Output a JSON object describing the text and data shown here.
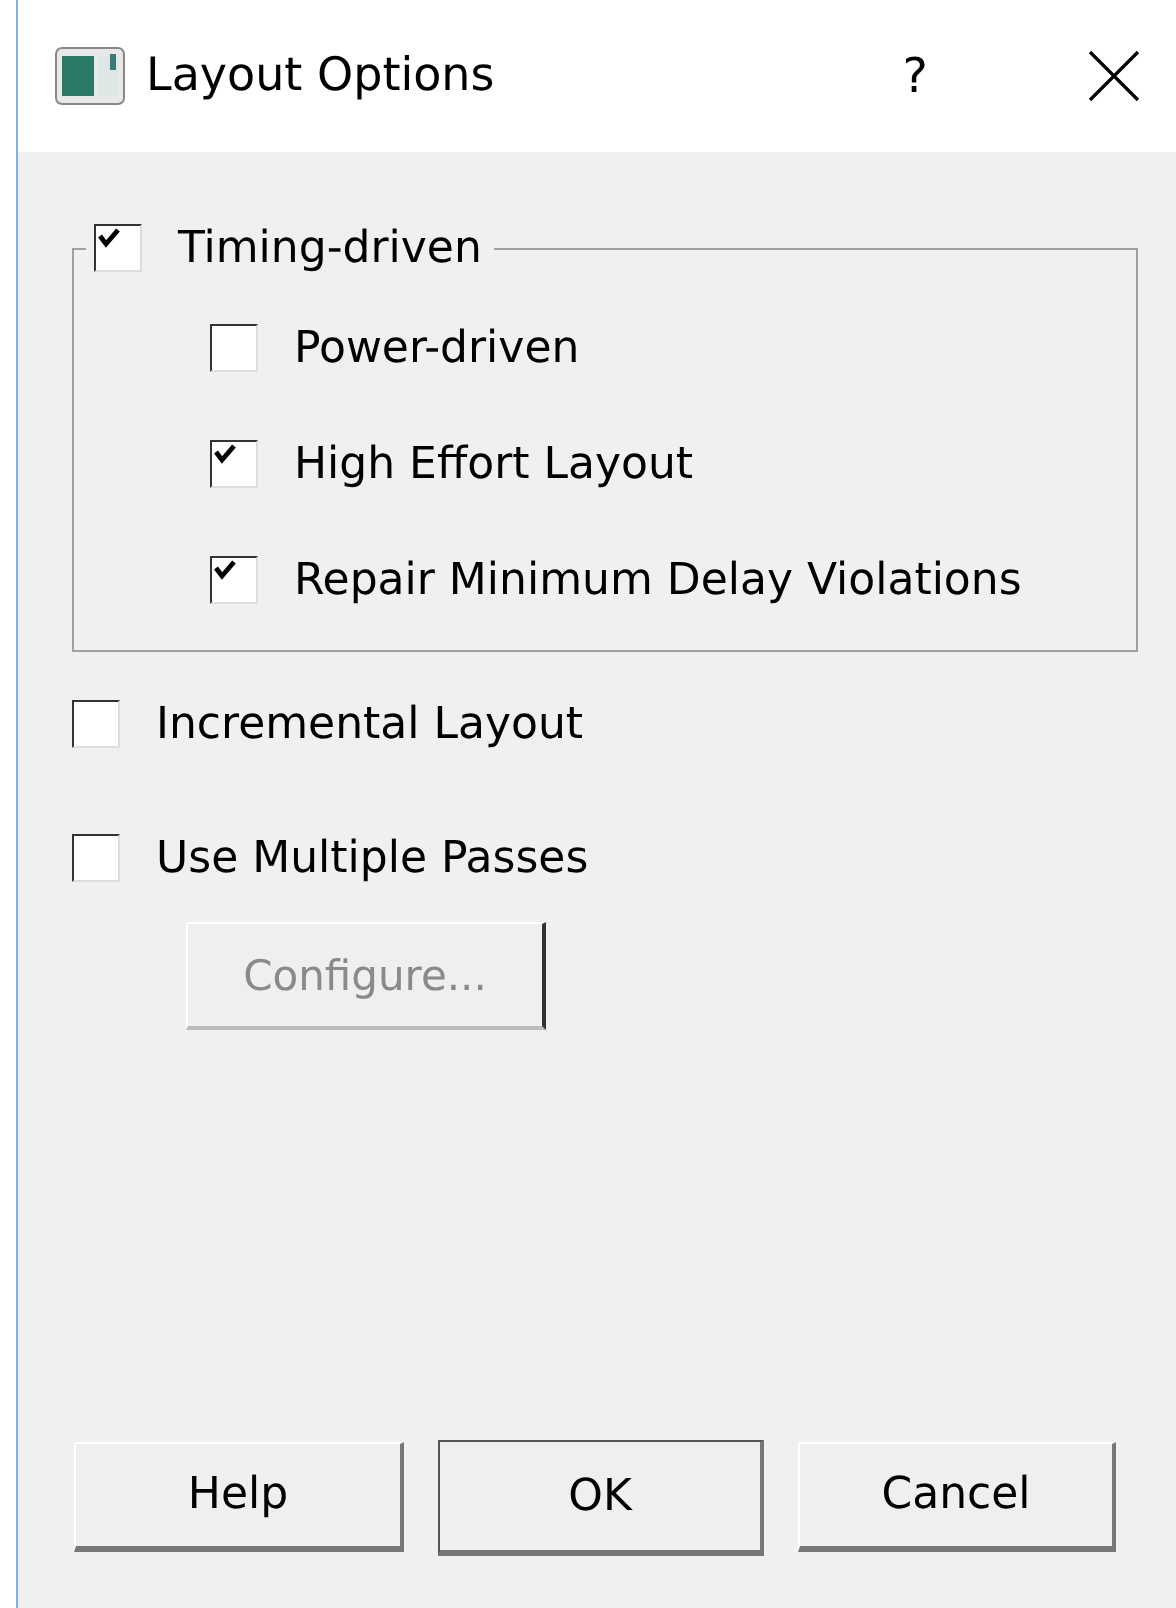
{
  "window": {
    "title": "Layout Options",
    "help": "?"
  },
  "group": {
    "label": "Timing-driven",
    "checked": true,
    "items": [
      {
        "label": "Power-driven",
        "checked": false
      },
      {
        "label": "High Effort Layout",
        "checked": true
      },
      {
        "label": "Repair Minimum Delay Violations",
        "checked": true
      }
    ]
  },
  "options": [
    {
      "label": "Incremental Layout",
      "checked": false
    },
    {
      "label": "Use Multiple Passes",
      "checked": false
    }
  ],
  "configure": {
    "label": "Configure...",
    "disabled": true
  },
  "buttons": [
    {
      "label": "Help",
      "default": false
    },
    {
      "label": "OK",
      "default": true
    },
    {
      "label": "Cancel",
      "default": false
    }
  ]
}
